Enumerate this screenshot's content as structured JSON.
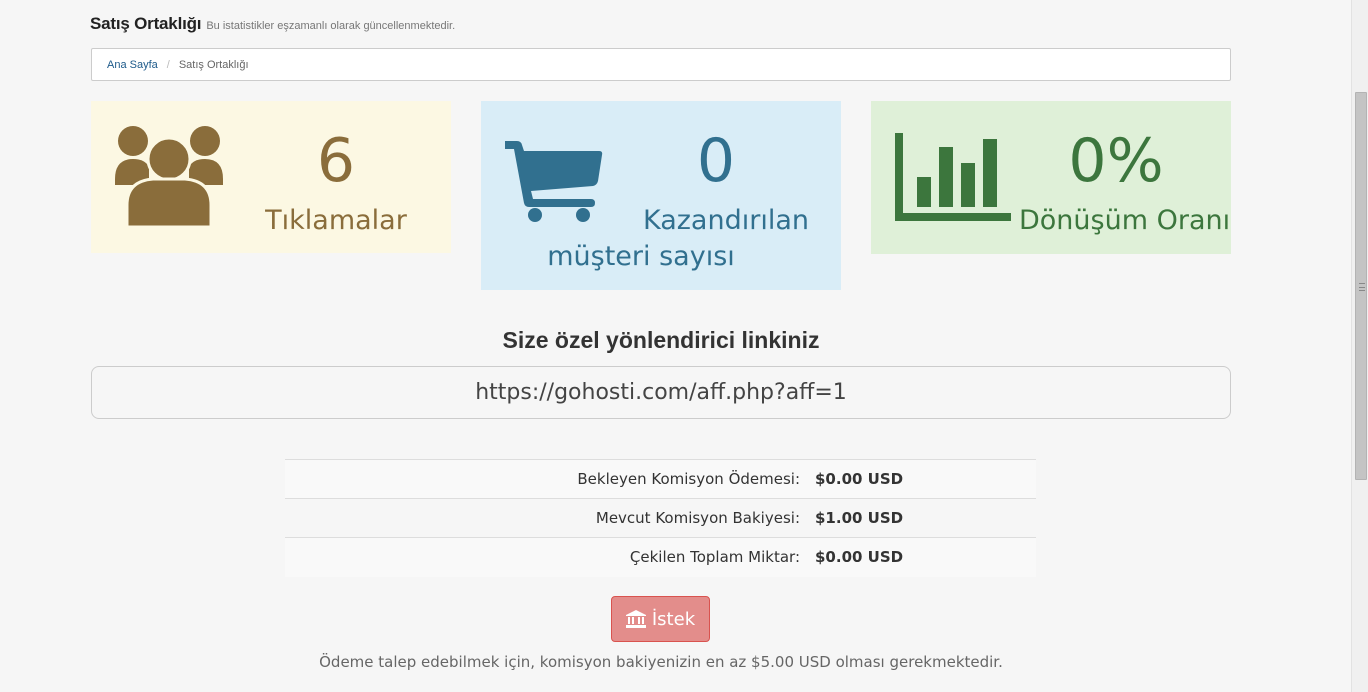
{
  "header": {
    "title": "Satış Ortaklığı",
    "subtitle": "Bu istatistikler eşzamanlı olarak güncellenmektedir."
  },
  "breadcrumb": {
    "home": "Ana Sayfa",
    "separator": "/",
    "current": "Satış Ortaklığı"
  },
  "stats": {
    "clicks": {
      "value": "6",
      "label": "Tıklamalar",
      "icon": "users-icon",
      "color": "#8a6d3b",
      "background": "#fcf8e3"
    },
    "customers": {
      "value": "0",
      "label_line1": "Kazandırılan",
      "label_line2": "müşteri sayısı",
      "icon": "shopping-cart-icon",
      "color": "#31708f",
      "background": "#d9edf7"
    },
    "conversion": {
      "value": "0%",
      "label": "Dönüşüm Oranı",
      "icon": "bar-chart-icon",
      "color": "#3c763d",
      "background": "#dff0d8"
    }
  },
  "referral": {
    "title": "Size özel yönlendirici linkiniz",
    "link": "https://gohosti.com/aff.php?aff=1"
  },
  "commissions": [
    {
      "label": "Bekleyen Komisyon Ödemesi:",
      "value": "$0.00 USD"
    },
    {
      "label": "Mevcut Komisyon Bakiyesi:",
      "value": "$1.00 USD"
    },
    {
      "label": "Çekilen Toplam Miktar:",
      "value": "$0.00 USD"
    }
  ],
  "request_button": {
    "label": "İstek",
    "icon": "bank-icon",
    "color": "#e38d8b"
  },
  "note": "Ödeme talep edebilmek için, komisyon bakiyenizin en az $5.00 USD olması gerekmektedir."
}
